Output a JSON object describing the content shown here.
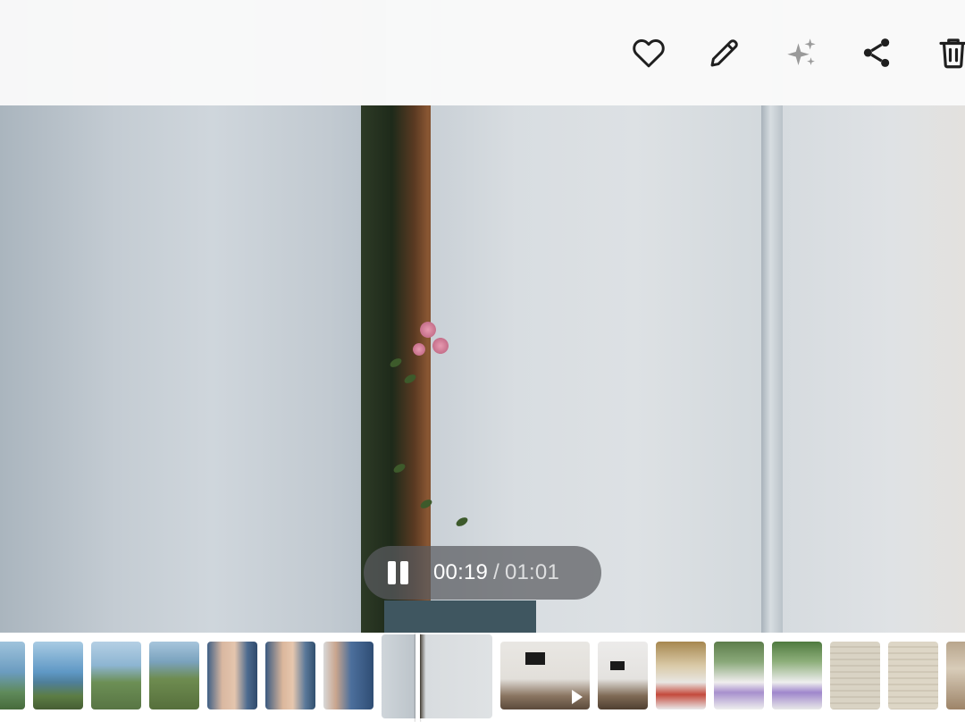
{
  "toolbar": {
    "actions": [
      {
        "name": "favorite",
        "icon": "heart-icon"
      },
      {
        "name": "edit",
        "icon": "pencil-icon"
      },
      {
        "name": "enhance",
        "icon": "sparkles-icon"
      },
      {
        "name": "share",
        "icon": "share-icon"
      },
      {
        "name": "delete",
        "icon": "trash-icon"
      }
    ]
  },
  "player": {
    "state": "playing",
    "control_icon": "pause-icon",
    "current_time": "00:19",
    "separator": "/",
    "duration": "01:01"
  },
  "filmstrip": {
    "current_index": 7,
    "items": [
      {
        "type": "photo",
        "subject": "sea-view"
      },
      {
        "type": "photo",
        "subject": "sea-view"
      },
      {
        "type": "photo",
        "subject": "hiking-people"
      },
      {
        "type": "photo",
        "subject": "hiking-people"
      },
      {
        "type": "photo",
        "subject": "child-portrait"
      },
      {
        "type": "photo",
        "subject": "child-portrait"
      },
      {
        "type": "photo",
        "subject": "child-portrait"
      },
      {
        "type": "video",
        "subject": "curtains"
      },
      {
        "type": "video",
        "subject": "room-with-tv"
      },
      {
        "type": "photo",
        "subject": "room-with-tv"
      },
      {
        "type": "photo",
        "subject": "restaurant-table"
      },
      {
        "type": "photo",
        "subject": "restaurant-table"
      },
      {
        "type": "photo",
        "subject": "restaurant-table"
      },
      {
        "type": "photo",
        "subject": "menu"
      },
      {
        "type": "photo",
        "subject": "menu"
      },
      {
        "type": "photo",
        "subject": "terrace"
      }
    ]
  },
  "colors": {
    "toolbar_bg": "#fafafa",
    "icon": "#1f1f1f",
    "icon_muted": "#9a9a9a",
    "pill_bg": "#5a5c60"
  }
}
